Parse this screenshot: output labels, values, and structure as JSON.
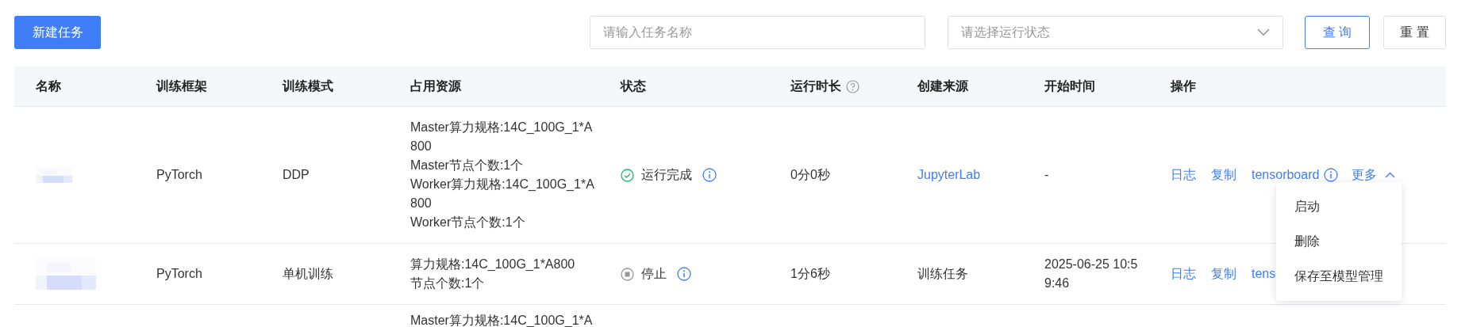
{
  "toolbar": {
    "new_button": "新建任务",
    "name_search": {
      "placeholder": "请输入任务名称"
    },
    "status_select": {
      "placeholder": "请选择运行状态"
    },
    "query_button": "查 询",
    "reset_button": "重 置"
  },
  "table": {
    "columns": [
      {
        "label": "名称",
        "help": false
      },
      {
        "label": "训练框架",
        "help": false
      },
      {
        "label": "训练模式",
        "help": false
      },
      {
        "label": "占用资源",
        "help": false
      },
      {
        "label": "状态",
        "help": false
      },
      {
        "label": "运行时长",
        "help": true
      },
      {
        "label": "创建来源",
        "help": false
      },
      {
        "label": "开始时间",
        "help": false
      },
      {
        "label": "操作",
        "help": false
      }
    ],
    "rows": [
      {
        "framework": "PyTorch",
        "mode": "DDP",
        "resources": [
          "Master算力规格:14C_100G_1*A800",
          "Master节点个数:1个",
          "Worker算力规格:14C_100G_1*A800",
          "Worker节点个数:1个"
        ],
        "status": {
          "kind": "completed",
          "label": "运行完成"
        },
        "duration": "0分0秒",
        "source": {
          "label": "JupyterLab",
          "link": true
        },
        "start_time": "-",
        "actions": [
          {
            "label": "日志",
            "kind": "link"
          },
          {
            "label": "复制",
            "kind": "link"
          },
          {
            "label": "tensorboard",
            "kind": "link_info"
          },
          {
            "label": "更多",
            "kind": "more",
            "expanded": true
          }
        ]
      },
      {
        "framework": "PyTorch",
        "mode": "单机训练",
        "resources": [
          "算力规格:14C_100G_1*A800",
          "节点个数:1个"
        ],
        "status": {
          "kind": "stopped",
          "label": "停止"
        },
        "duration": "1分6秒",
        "source": {
          "label": "训练任务",
          "link": false
        },
        "start_time": "2025-06-25 10:59:46",
        "actions": [
          {
            "label": "日志",
            "kind": "link"
          },
          {
            "label": "复制",
            "kind": "link"
          },
          {
            "label": "tens",
            "kind": "link"
          }
        ]
      },
      {
        "resources": [
          "Master算力规格:14C_100G_1*A"
        ]
      }
    ]
  },
  "more_menu": {
    "items": [
      "启动",
      "删除",
      "保存至模型管理"
    ]
  }
}
